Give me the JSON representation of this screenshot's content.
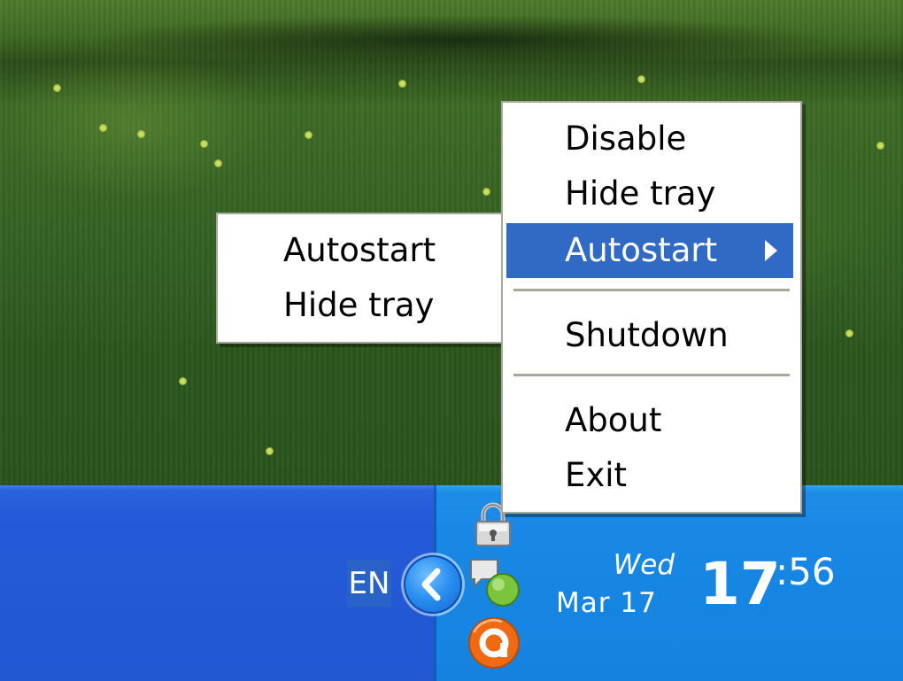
{
  "menu": {
    "items": [
      {
        "label": "Disable"
      },
      {
        "label": "Hide tray"
      },
      {
        "label": "Autostart",
        "has_submenu": true,
        "selected": true
      },
      {
        "label": "Shutdown"
      },
      {
        "label": "About"
      },
      {
        "label": "Exit"
      }
    ]
  },
  "submenu": {
    "items": [
      {
        "label": "Autostart"
      },
      {
        "label": "Hide tray"
      }
    ]
  },
  "taskbar": {
    "language": "EN",
    "clock": {
      "day": "Wed",
      "date": "Mar 17",
      "hour": "17",
      "minute": ":56"
    },
    "tray_icons": [
      "show-hidden-icons-icon",
      "lock-icon",
      "chat-status-icon",
      "orange-app-icon"
    ]
  },
  "colors": {
    "menu_highlight": "#316ac5",
    "taskbar_blue": "#245bd8",
    "tray_blue": "#1888e4"
  }
}
